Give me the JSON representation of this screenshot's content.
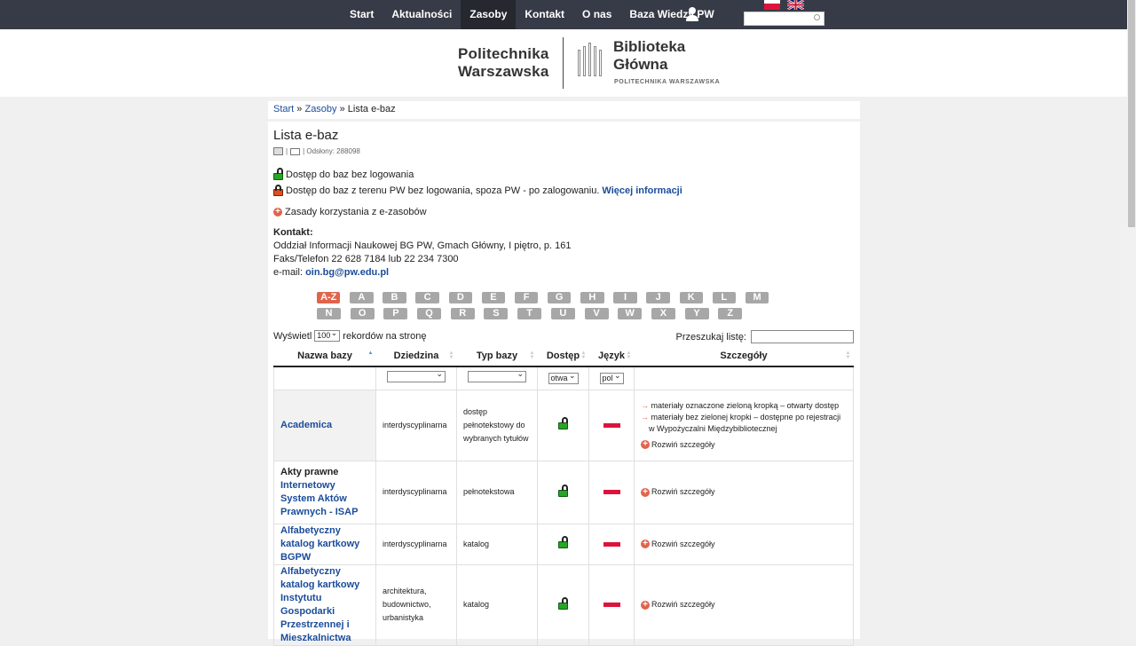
{
  "nav": {
    "items": [
      {
        "label": "Start",
        "active": false
      },
      {
        "label": "Aktualności",
        "active": false
      },
      {
        "label": "Zasoby",
        "active": true
      },
      {
        "label": "Kontakt",
        "active": false
      },
      {
        "label": "O nas",
        "active": false
      },
      {
        "label": "Baza Wiedzy PW",
        "active": false
      }
    ],
    "user_icon": "user-icon",
    "search_placeholder": ""
  },
  "header": {
    "logo_pw_line1": "Politechnika",
    "logo_pw_line2": "Warszawska",
    "logo_bg_line1": "Biblioteka",
    "logo_bg_line2": "Główna",
    "logo_bg_sub": "POLITECHNIKA WARSZAWSKA"
  },
  "breadcrumb": {
    "start": "Start",
    "sep1": " » ",
    "zasoby": "Zasoby",
    "sep2": " » ",
    "current": "Lista e-baz"
  },
  "page": {
    "title": "Lista e-baz",
    "views": "| Odsłony: 288098",
    "legend_open": "Dostęp do baz bez logowania",
    "legend_closed": "Dostęp do baz z terenu PW bez logowania, spoza PW - po zalogowaniu.",
    "legend_more": "Więcej informacji",
    "rules": "Zasady korzystania z e-zasobów",
    "contact_label": "Kontakt:",
    "contact_line1": "Oddział Informacji Naukowej BG PW, Gmach Główny, I piętro, p. 161",
    "contact_line2": "Faks/Telefon 22 628 7184 lub 22 234 7300",
    "contact_email_label": "e-mail: ",
    "contact_email": "oin.bg@pw.edu.pl"
  },
  "letters_row1": [
    "A-Z",
    "A",
    "B",
    "C",
    "D",
    "E",
    "F",
    "G",
    "H",
    "I",
    "J",
    "K",
    "L",
    "M"
  ],
  "letters_row2": [
    "N",
    "O",
    "P",
    "Q",
    "R",
    "S",
    "T",
    "U",
    "V",
    "W",
    "X",
    "Y",
    "Z"
  ],
  "controls": {
    "show_label": "Wyświetl",
    "show_value": "100",
    "show_suffix": "rekordów na stronę",
    "search_label": "Przeszukaj listę:"
  },
  "table": {
    "headers": [
      "Nazwa bazy",
      "Dziedzina",
      "Typ bazy",
      "Dostęp",
      "Język",
      "Szczegóły"
    ],
    "filter_access": "otwa",
    "filter_lang": "pol",
    "rows": [
      {
        "name": "Academica",
        "domain": "interdyscyplinarna",
        "type": "dostęp pełnotekstowy do wybranych tytułów",
        "details": [
          "materiały oznaczone zieloną kropką – otwarty dostęp",
          "materiały bez zielonej kropki – dostępne po rejestracji w Wypożyczalni Międzybibliotecznej"
        ],
        "expand": "Rozwiń szczegóły"
      },
      {
        "name_plain": "Akty prawne",
        "name": "Internetowy System Aktów Prawnych - ISAP",
        "domain": "interdyscyplinarna",
        "type": "pełnotekstowa",
        "expand": "Rozwiń szczegóły"
      },
      {
        "name": "Alfabetyczny katalog kartkowy BGPW",
        "domain": "interdyscyplinarna",
        "type": "katalog",
        "expand": "Rozwiń szczegóły"
      },
      {
        "name": "Alfabetyczny katalog kartkowy Instytutu Gospodarki Przestrzennej i Mieszkalnictwa",
        "domain": "architektura, budownictwo, urbanistyka",
        "type": "katalog",
        "expand": "Rozwiń szczegóły"
      }
    ]
  },
  "colors": {
    "nav_bg": "#373b47",
    "link": "#1a4c9a",
    "accent": "#e0644c",
    "lock_open": "#27a527"
  }
}
